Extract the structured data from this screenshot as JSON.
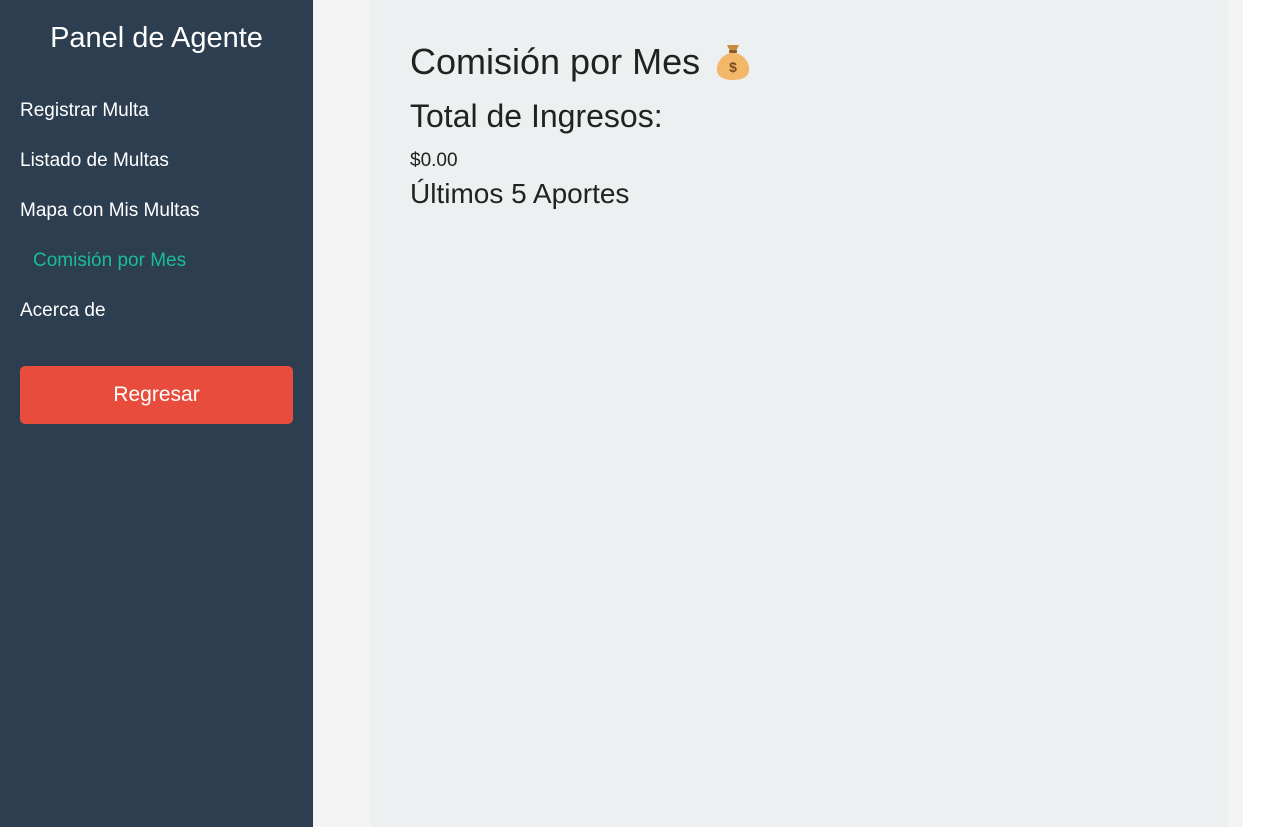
{
  "sidebar": {
    "title": "Panel de Agente",
    "items": [
      {
        "label": "Registrar Multa"
      },
      {
        "label": "Listado de Multas"
      },
      {
        "label": "Mapa con Mis Multas"
      },
      {
        "label": "Comisión por Mes",
        "active": true
      },
      {
        "label": "Acerca de"
      }
    ],
    "back_label": "Regresar"
  },
  "main": {
    "title": "Comisión por Mes",
    "title_icon": "money-bag-icon",
    "total_label": "Total de Ingresos:",
    "total_value": "$0.00",
    "recent_label": "Últimos 5 Aportes"
  },
  "colors": {
    "sidebar_bg": "#2c3e50",
    "active_item": "#1abc9c",
    "back_button": "#e74c3c",
    "content_bg": "#ecf0f1"
  }
}
